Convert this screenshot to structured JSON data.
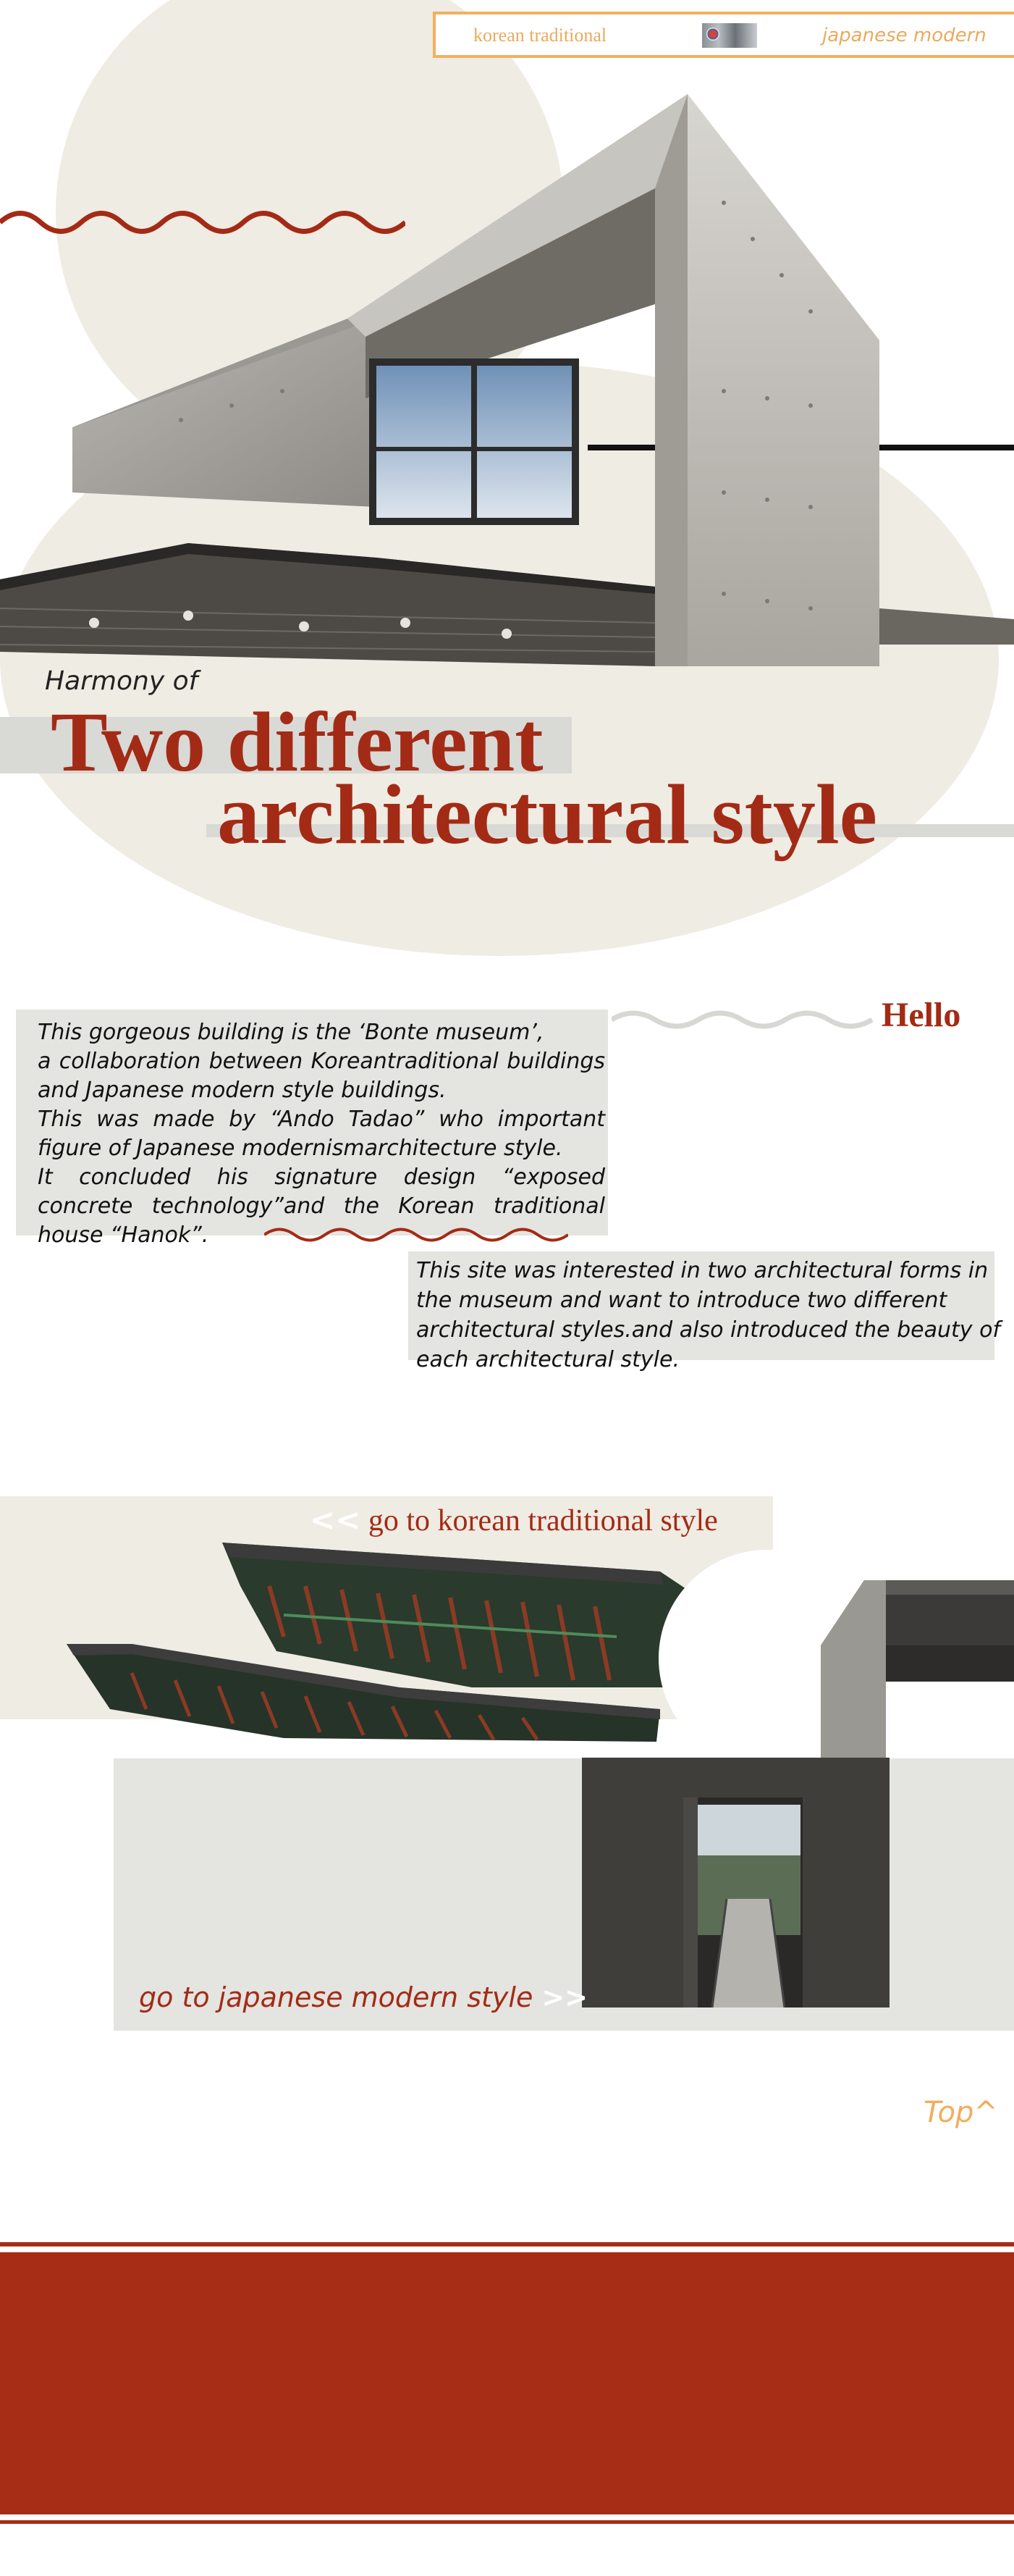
{
  "nav": {
    "korean_label": "korean traditional",
    "japanese_label": "japanese modern"
  },
  "hero": {
    "subtitle": "Harmony of",
    "title_line1": "Two different",
    "title_line2": "architectural style"
  },
  "intro": {
    "paragraphs": [
      "This gorgeous building is the ‘Bonte museum’,",
      "a collaboration between Koreantraditional buildings and Japanese modern style buildings.",
      "This was made by “Ando Tadao” who important figure of Japanese modernismarchitecture style.",
      "It concluded his signature design “exposed concrete technology”and the Korean traditional house “Hanok”."
    ]
  },
  "hello": {
    "heading": "Hello",
    "text": "This site was  interested in two architectural forms in the museum and  want to introduce two different architectural styles.and also introduced the beauty of each architectural style."
  },
  "links": {
    "korean_arrows": "<<",
    "korean_label": "go to korean traditional style",
    "japanese_label": "go to japanese modern style",
    "japanese_arrows": ">>",
    "top_label": "Top^"
  },
  "colors": {
    "accent": "#a32b16",
    "nav": "#f3b05f",
    "beige": "#efece3",
    "grey": "#e4e4e0"
  },
  "icons": {
    "nav_thumbnail": "tile-pattern-icon"
  }
}
